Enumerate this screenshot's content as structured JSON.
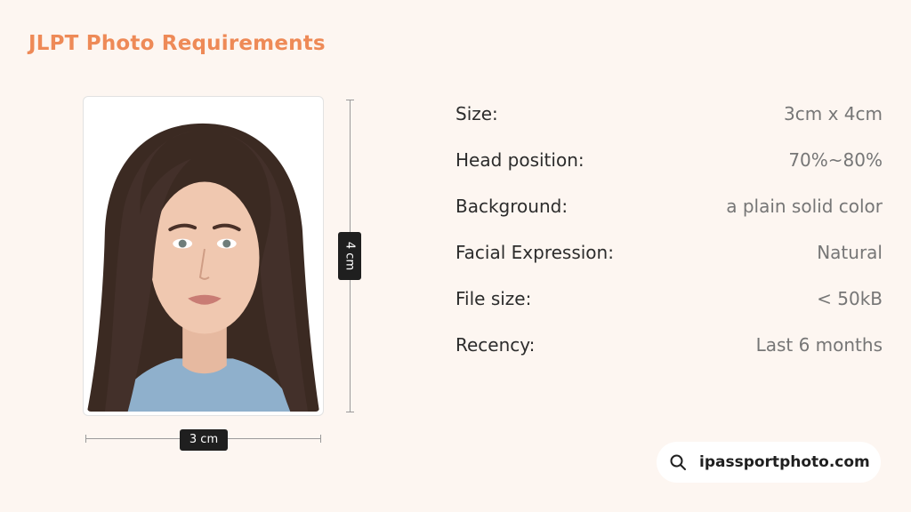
{
  "title": "JLPT Photo Requirements",
  "dimensions": {
    "width_label": "3 cm",
    "height_label": "4 cm"
  },
  "specs": [
    {
      "label": "Size:",
      "value": "3cm x 4cm"
    },
    {
      "label": "Head position:",
      "value": "70%~80%"
    },
    {
      "label": "Background:",
      "value": "a plain solid color"
    },
    {
      "label": "Facial Expression:",
      "value": "Natural"
    },
    {
      "label": "File size:",
      "value": "< 50kB"
    },
    {
      "label": "Recency:",
      "value": "Last 6 months"
    }
  ],
  "brand": {
    "icon": "search-icon",
    "text": "ipassportphoto.com"
  },
  "colors": {
    "accent": "#ee8a57",
    "background": "#fdf6f1",
    "tag": "#1f1f1f"
  }
}
